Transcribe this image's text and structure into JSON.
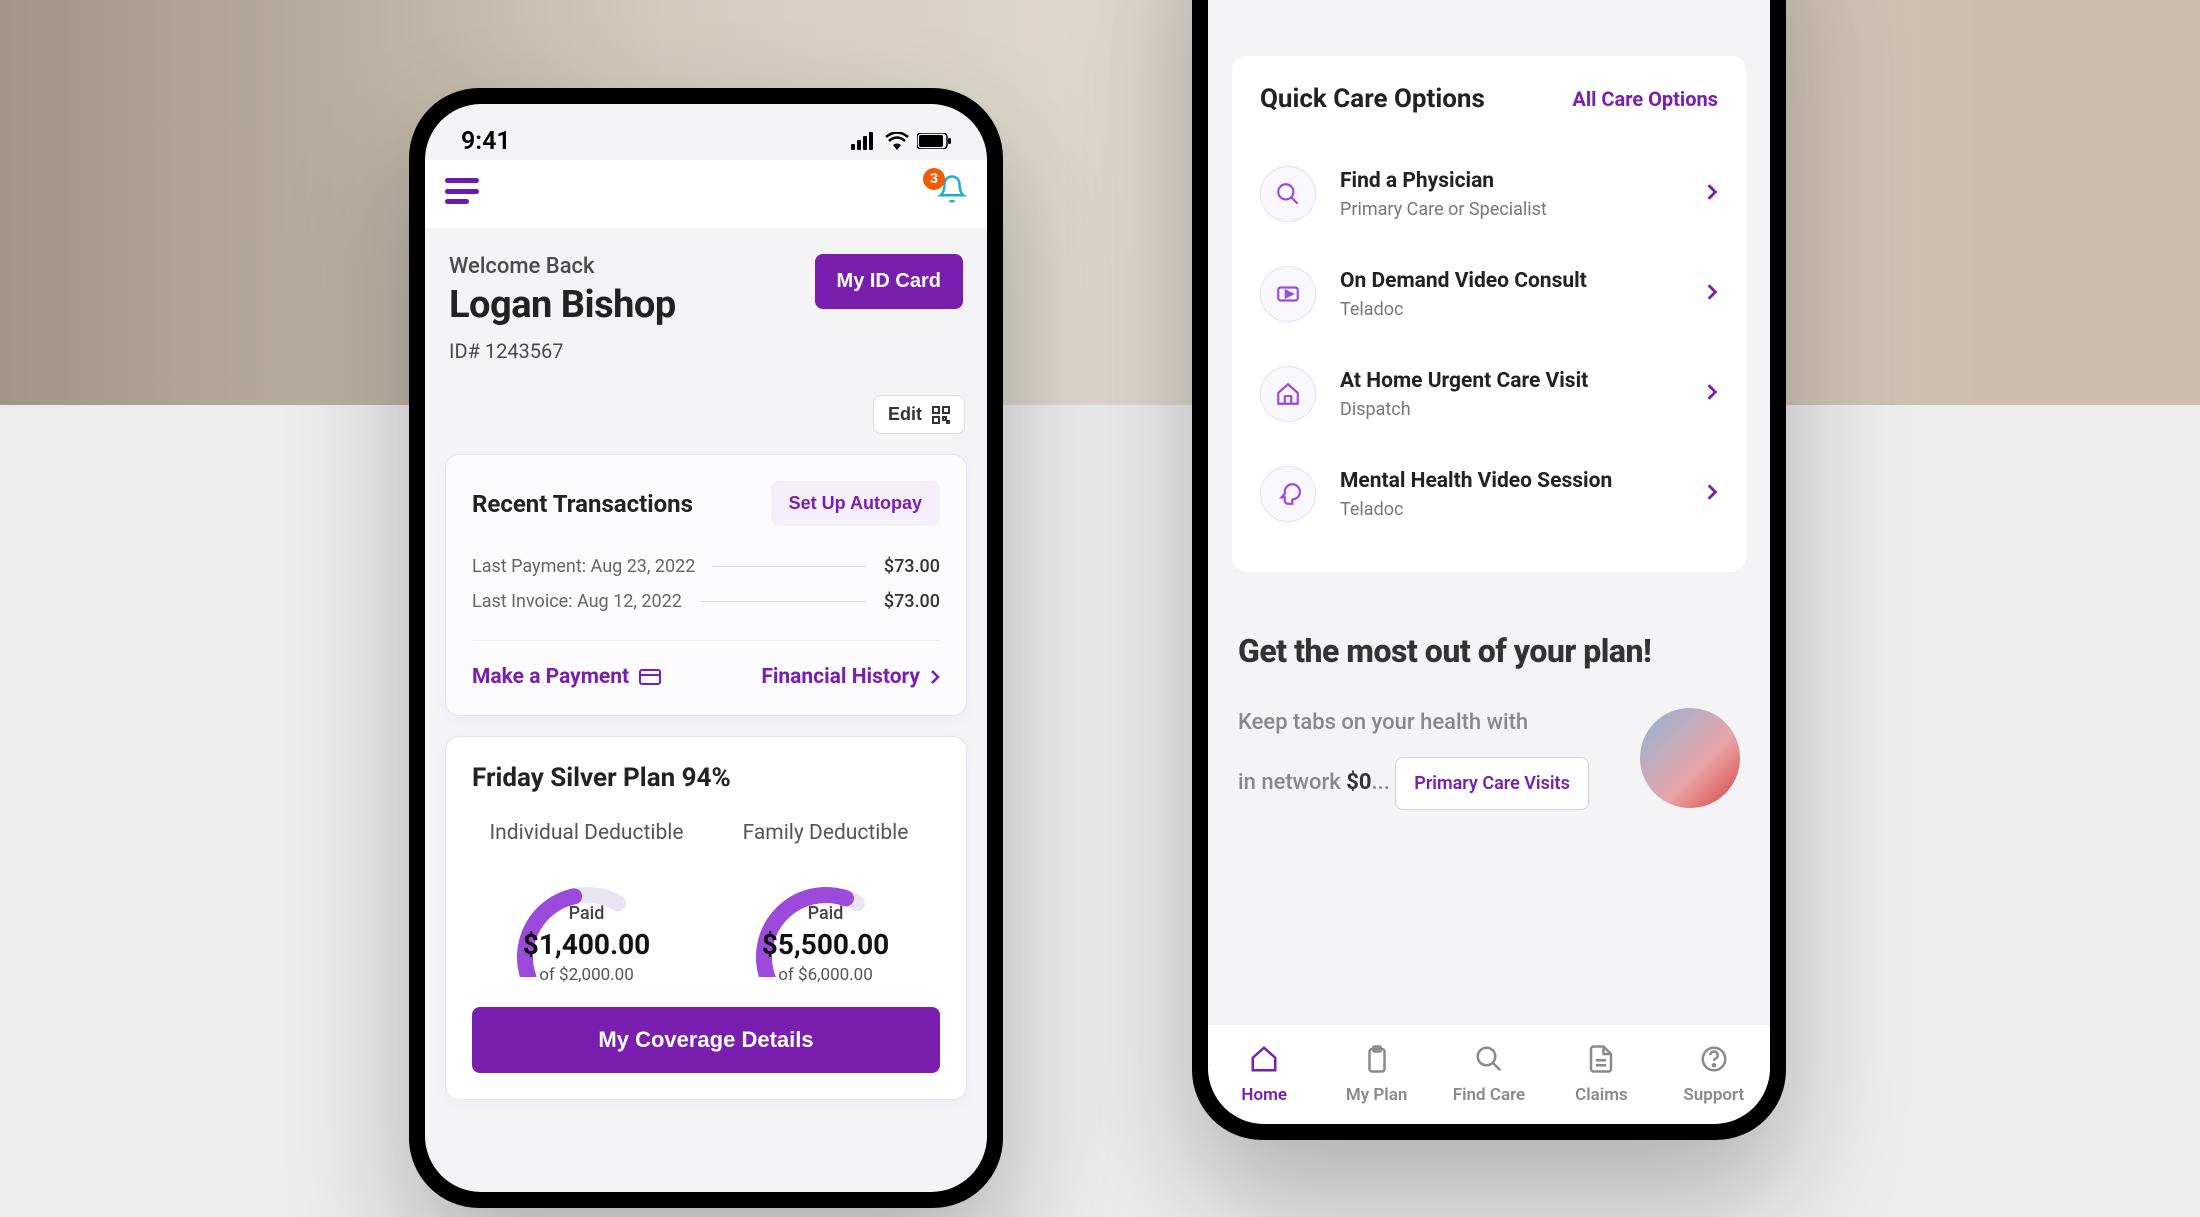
{
  "statusbar": {
    "time": "9:41"
  },
  "appbar": {
    "notification_count": "3"
  },
  "header": {
    "welcome": "Welcome Back",
    "name": "Logan Bishop",
    "id_label": "ID# 1243567",
    "id_card_btn": "My ID Card",
    "edit_label": "Edit"
  },
  "transactions": {
    "title": "Recent Transactions",
    "autopay_btn": "Set Up Autopay",
    "rows": [
      {
        "label": "Last Payment: Aug 23, 2022",
        "amount": "$73.00"
      },
      {
        "label": "Last Invoice: Aug 12, 2022",
        "amount": "$73.00"
      }
    ],
    "make_payment": "Make a Payment",
    "fin_history": "Financial History"
  },
  "plan": {
    "title": "Friday Silver Plan 94%",
    "gauges": [
      {
        "title": "Individual Deductible",
        "paid_label": "Paid",
        "amount": "$1,400.00",
        "of": "of $2,000.00",
        "pct": 70
      },
      {
        "title": "Family Deductible",
        "paid_label": "Paid",
        "amount": "$5,500.00",
        "of": "of $6,000.00",
        "pct": 92
      }
    ],
    "details_btn": "My Coverage Details"
  },
  "quickcare": {
    "title": "Quick Care Options",
    "all_label": "All Care Options",
    "items": [
      {
        "title": "Find a Physician",
        "sub": "Primary Care or Specialist",
        "icon": "search"
      },
      {
        "title": "On Demand Video Consult",
        "sub": "Teladoc",
        "icon": "video"
      },
      {
        "title": "At Home Urgent Care Visit",
        "sub": "Dispatch",
        "icon": "home"
      },
      {
        "title": "Mental Health Video Session",
        "sub": "Teladoc",
        "icon": "head"
      }
    ]
  },
  "promo": {
    "heading": "Get the most out of your plan!",
    "line1": "Keep tabs on your health with",
    "line2_prefix": "in network ",
    "line2_bold": "$0",
    "line2_suffix": "...",
    "pill": "Primary Care Visits"
  },
  "tabs": [
    {
      "label": "Home",
      "icon": "home",
      "active": true
    },
    {
      "label": "My Plan",
      "icon": "clipboard",
      "active": false
    },
    {
      "label": "Find Care",
      "icon": "search",
      "active": false
    },
    {
      "label": "Claims",
      "icon": "file",
      "active": false
    },
    {
      "label": "Support",
      "icon": "help",
      "active": false
    }
  ]
}
